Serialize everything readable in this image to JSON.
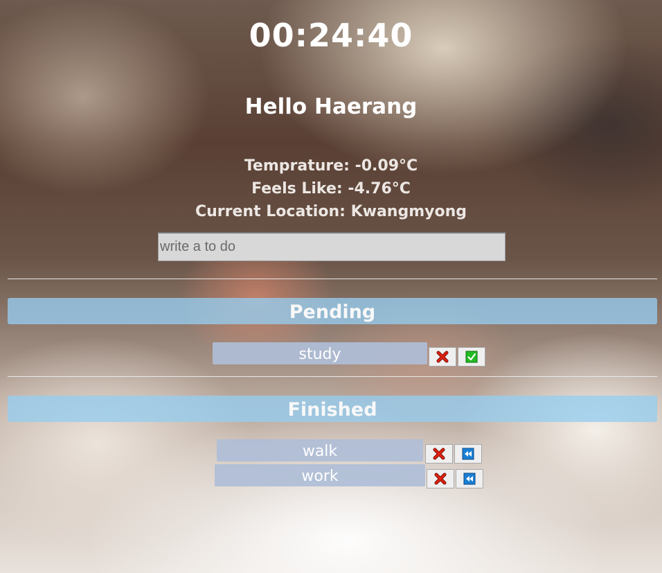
{
  "clock": {
    "time": "00:24:40"
  },
  "greeting": {
    "text": "Hello Haerang"
  },
  "weather": {
    "temperature": "Temprature: -0.09°C",
    "feels_like": "Feels Like: -4.76°C",
    "location": "Current Location: Kwangmyong"
  },
  "todo_form": {
    "placeholder": "write a to do",
    "value": ""
  },
  "pending": {
    "title": "Pending",
    "items": [
      {
        "text": "study",
        "delete_icon": "red-x-icon",
        "action_icon": "green-check-icon"
      }
    ]
  },
  "finished": {
    "title": "Finished",
    "items": [
      {
        "text": "walk",
        "delete_icon": "red-x-icon",
        "action_icon": "blue-rewind-icon"
      },
      {
        "text": "work",
        "delete_icon": "red-x-icon",
        "action_icon": "blue-rewind-icon"
      }
    ]
  },
  "colors": {
    "section_bar": "#96CDF0",
    "item_bg": "#AFBED7",
    "check_green": "#22BB22",
    "rewind_blue": "#1A7FD4",
    "delete_red": "#E02010"
  }
}
